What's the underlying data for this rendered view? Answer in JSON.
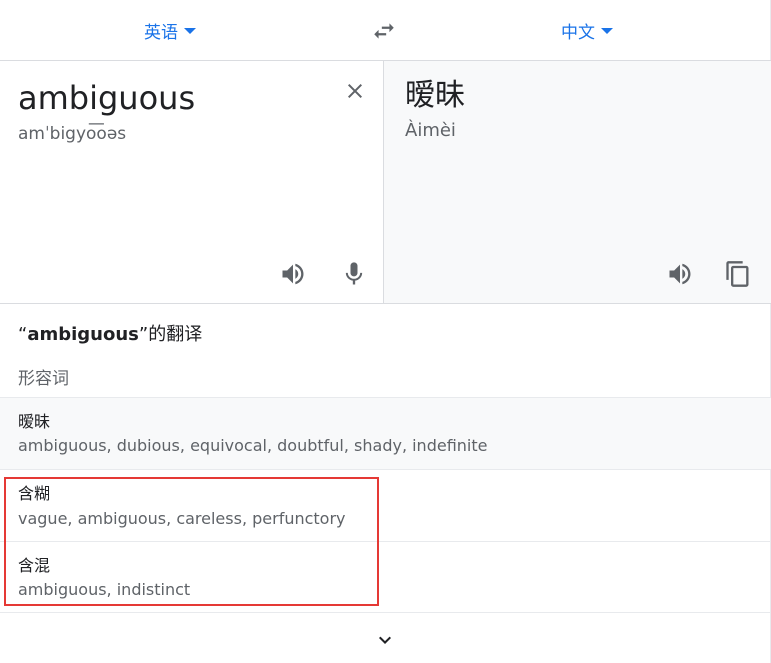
{
  "language_bar": {
    "source_language": "英语",
    "target_language": "中文",
    "source_dropdown_icon": "caret-down-icon",
    "swap_icon": "swap-languages-icon",
    "target_dropdown_icon": "caret-down-icon",
    "accent_color": "#1a73e8"
  },
  "source_panel": {
    "text": "ambiguous",
    "phonetic": "amˈbigyo͞oəs",
    "clear_icon": "close-icon",
    "speaker_icon": "speaker-icon",
    "mic_icon": "microphone-icon"
  },
  "target_panel": {
    "text": "暧昧",
    "romanization": "Àimèi",
    "speaker_icon": "speaker-icon",
    "copy_icon": "copy-icon"
  },
  "dictionary": {
    "title_open_quote": "“",
    "title_word": "ambiguous",
    "title_suffix": "”的翻译",
    "part_of_speech": "形容词",
    "entries": [
      {
        "word": "暧昧",
        "synonyms": "ambiguous, dubious, equivocal, doubtful, shady, indefinite"
      },
      {
        "word": "含糊",
        "synonyms": "vague, ambiguous, careless, perfunctory"
      },
      {
        "word": "含混",
        "synonyms": "ambiguous, indistinct"
      }
    ],
    "expand_icon": "chevron-down-icon",
    "highlight_color": "#e53935"
  }
}
